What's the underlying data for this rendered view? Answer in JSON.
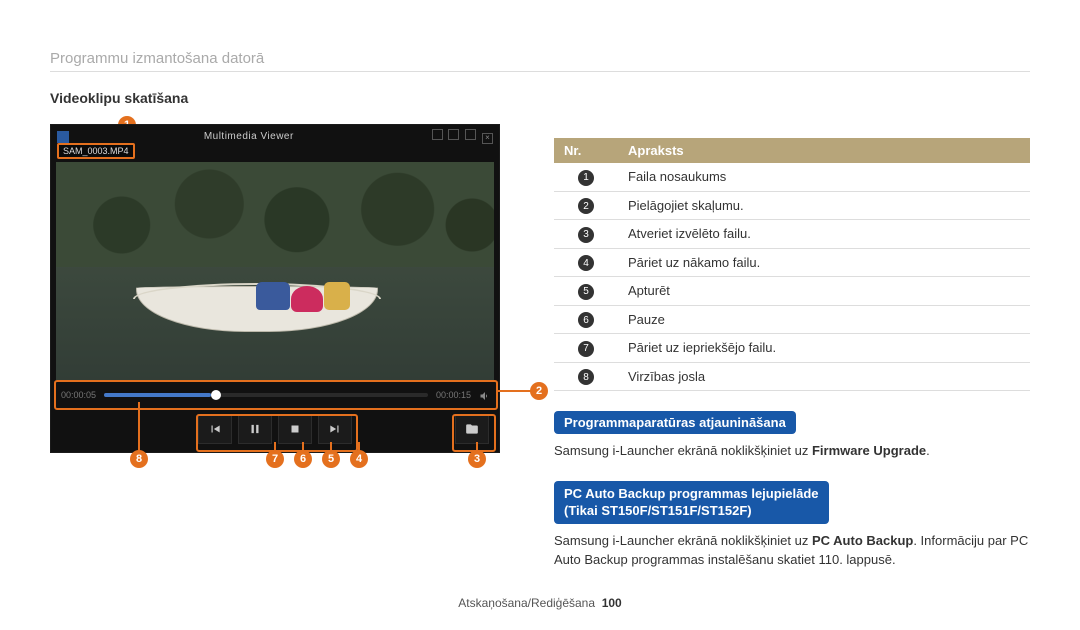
{
  "breadcrumb": "Programmu izmantošana datorā",
  "section_title": "Videoklipu skatīšana",
  "viewer": {
    "app_title": "Multimedia Viewer",
    "filename": "SAM_0003.MP4",
    "time_cur": "00:00:05",
    "time_total": "00:00:15"
  },
  "table": {
    "head_nr": "Nr.",
    "head_desc": "Apraksts",
    "rows": [
      {
        "n": "1",
        "d": "Faila nosaukums"
      },
      {
        "n": "2",
        "d": "Pielāgojiet skaļumu."
      },
      {
        "n": "3",
        "d": "Atveriet izvēlēto failu."
      },
      {
        "n": "4",
        "d": "Pāriet uz nākamo failu."
      },
      {
        "n": "5",
        "d": "Apturēt"
      },
      {
        "n": "6",
        "d": "Pauze"
      },
      {
        "n": "7",
        "d": "Pāriet uz iepriekšējo failu."
      },
      {
        "n": "8",
        "d": "Virzības josla"
      }
    ]
  },
  "fw": {
    "head": "Programmaparatūras atjaunināšana",
    "text_a": "Samsung i-Launcher ekrānā noklikšķiniet uz ",
    "text_b": "Firmware Upgrade",
    "text_c": "."
  },
  "pcab": {
    "head1": "PC Auto Backup programmas lejupielāde",
    "head2": "(Tikai ST150F/ST151F/ST152F)",
    "text_a": "Samsung i-Launcher ekrānā noklikšķiniet uz ",
    "text_b": "PC Auto Backup",
    "text_c": ". Informāciju par PC Auto Backup programmas instalēšanu skatiet 110. lappusē."
  },
  "footer": {
    "section": "Atskaņošana/Rediģēšana",
    "page": "100"
  },
  "callouts": {
    "1": "1",
    "2": "2",
    "3": "3",
    "4": "4",
    "5": "5",
    "6": "6",
    "7": "7",
    "8": "8"
  }
}
